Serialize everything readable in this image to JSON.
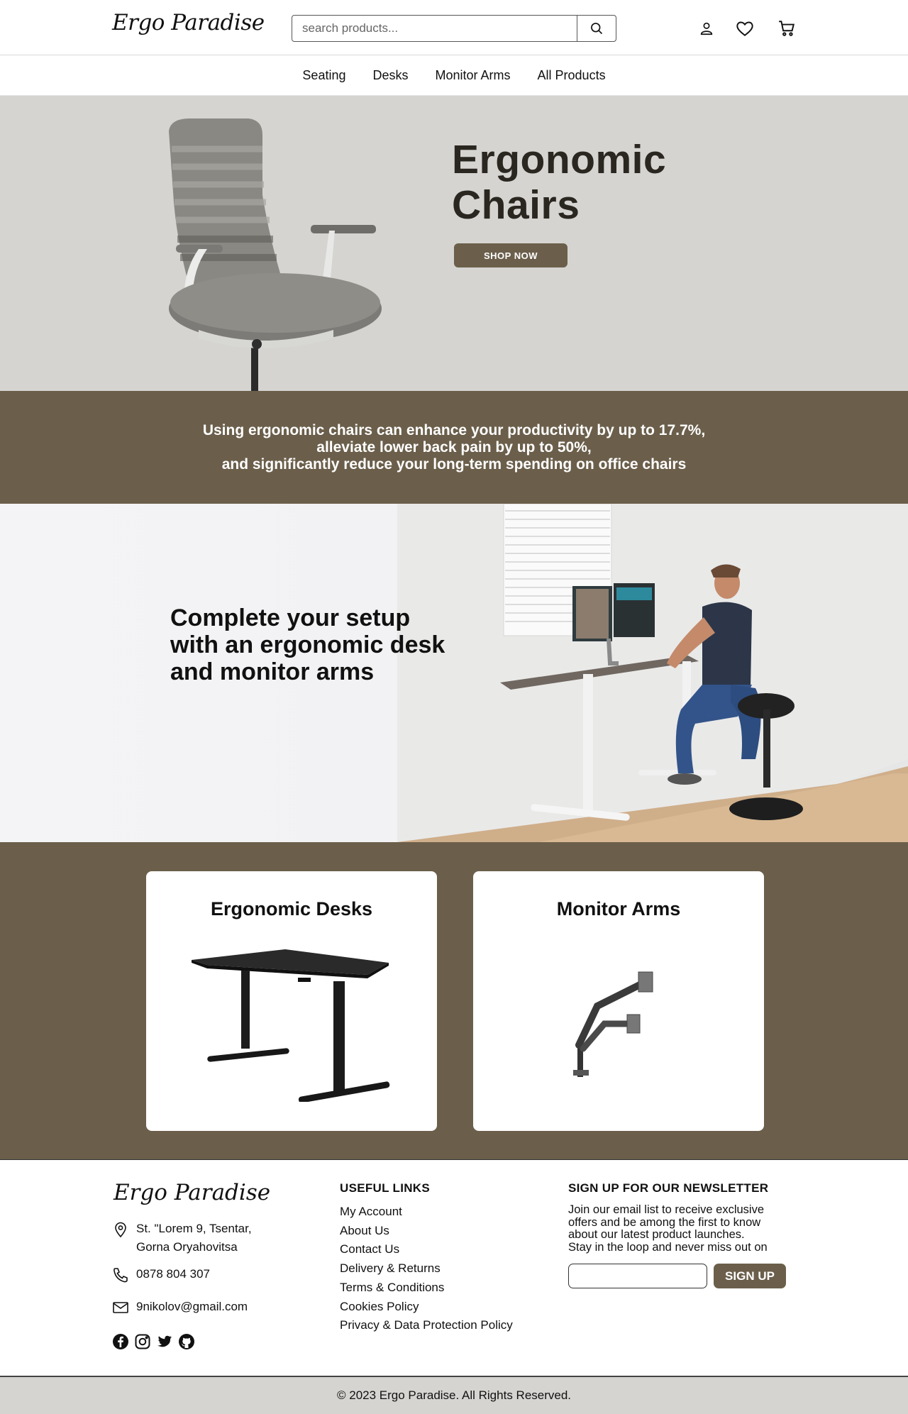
{
  "header": {
    "logo": "Ergo Paradise",
    "search_placeholder": "search products...",
    "icons": [
      "user-icon",
      "heart-icon",
      "cart-icon"
    ]
  },
  "nav": {
    "items": [
      "Seating",
      "Desks",
      "Monitor Arms",
      "All Products"
    ]
  },
  "hero": {
    "title_line1": "Ergonomic",
    "title_line2": "Chairs",
    "button": "SHOP NOW"
  },
  "stat_band": {
    "line1": "Using ergonomic chairs can enhance your productivity by up to 17.7%,",
    "line2": "alleviate lower back pain by up to 50%,",
    "line3": "and significantly reduce your long-term spending on office chairs"
  },
  "setup": {
    "line1": "Complete your setup",
    "line2": "with an ergonomic desk",
    "line3": "and monitor arms"
  },
  "cards": [
    {
      "title": "Ergonomic Desks"
    },
    {
      "title": "Monitor Arms"
    }
  ],
  "footer": {
    "logo": "Ergo Paradise",
    "address_line1": "St. \"Lorem 9, Tsentar,",
    "address_line2": "Gorna Oryahovitsa",
    "phone": "0878 804 307",
    "email": "9nikolov@gmail.com",
    "useful_links_title": "USEFUL LINKS",
    "useful_links": [
      "My Account",
      "About Us",
      "Contact Us",
      "Delivery & Returns",
      "Terms & Conditions",
      "Cookies Policy",
      "Privacy & Data Protection Policy"
    ],
    "newsletter_title": "SIGN UP FOR OUR NEWSLETTER",
    "newsletter_lines": [
      "Join our email list to receive exclusive",
      "offers and be among the first to know",
      "about our latest product launches.",
      "Stay in the loop and never miss out on"
    ],
    "newsletter_button": "SIGN UP",
    "socials": [
      "facebook-icon",
      "instagram-icon",
      "twitter-icon",
      "github-icon"
    ]
  },
  "copyright": "© 2023 Ergo Paradise. All Rights Reserved.",
  "colors": {
    "brand": "#6b5f4b",
    "hero_bg": "#d5d4d1"
  }
}
